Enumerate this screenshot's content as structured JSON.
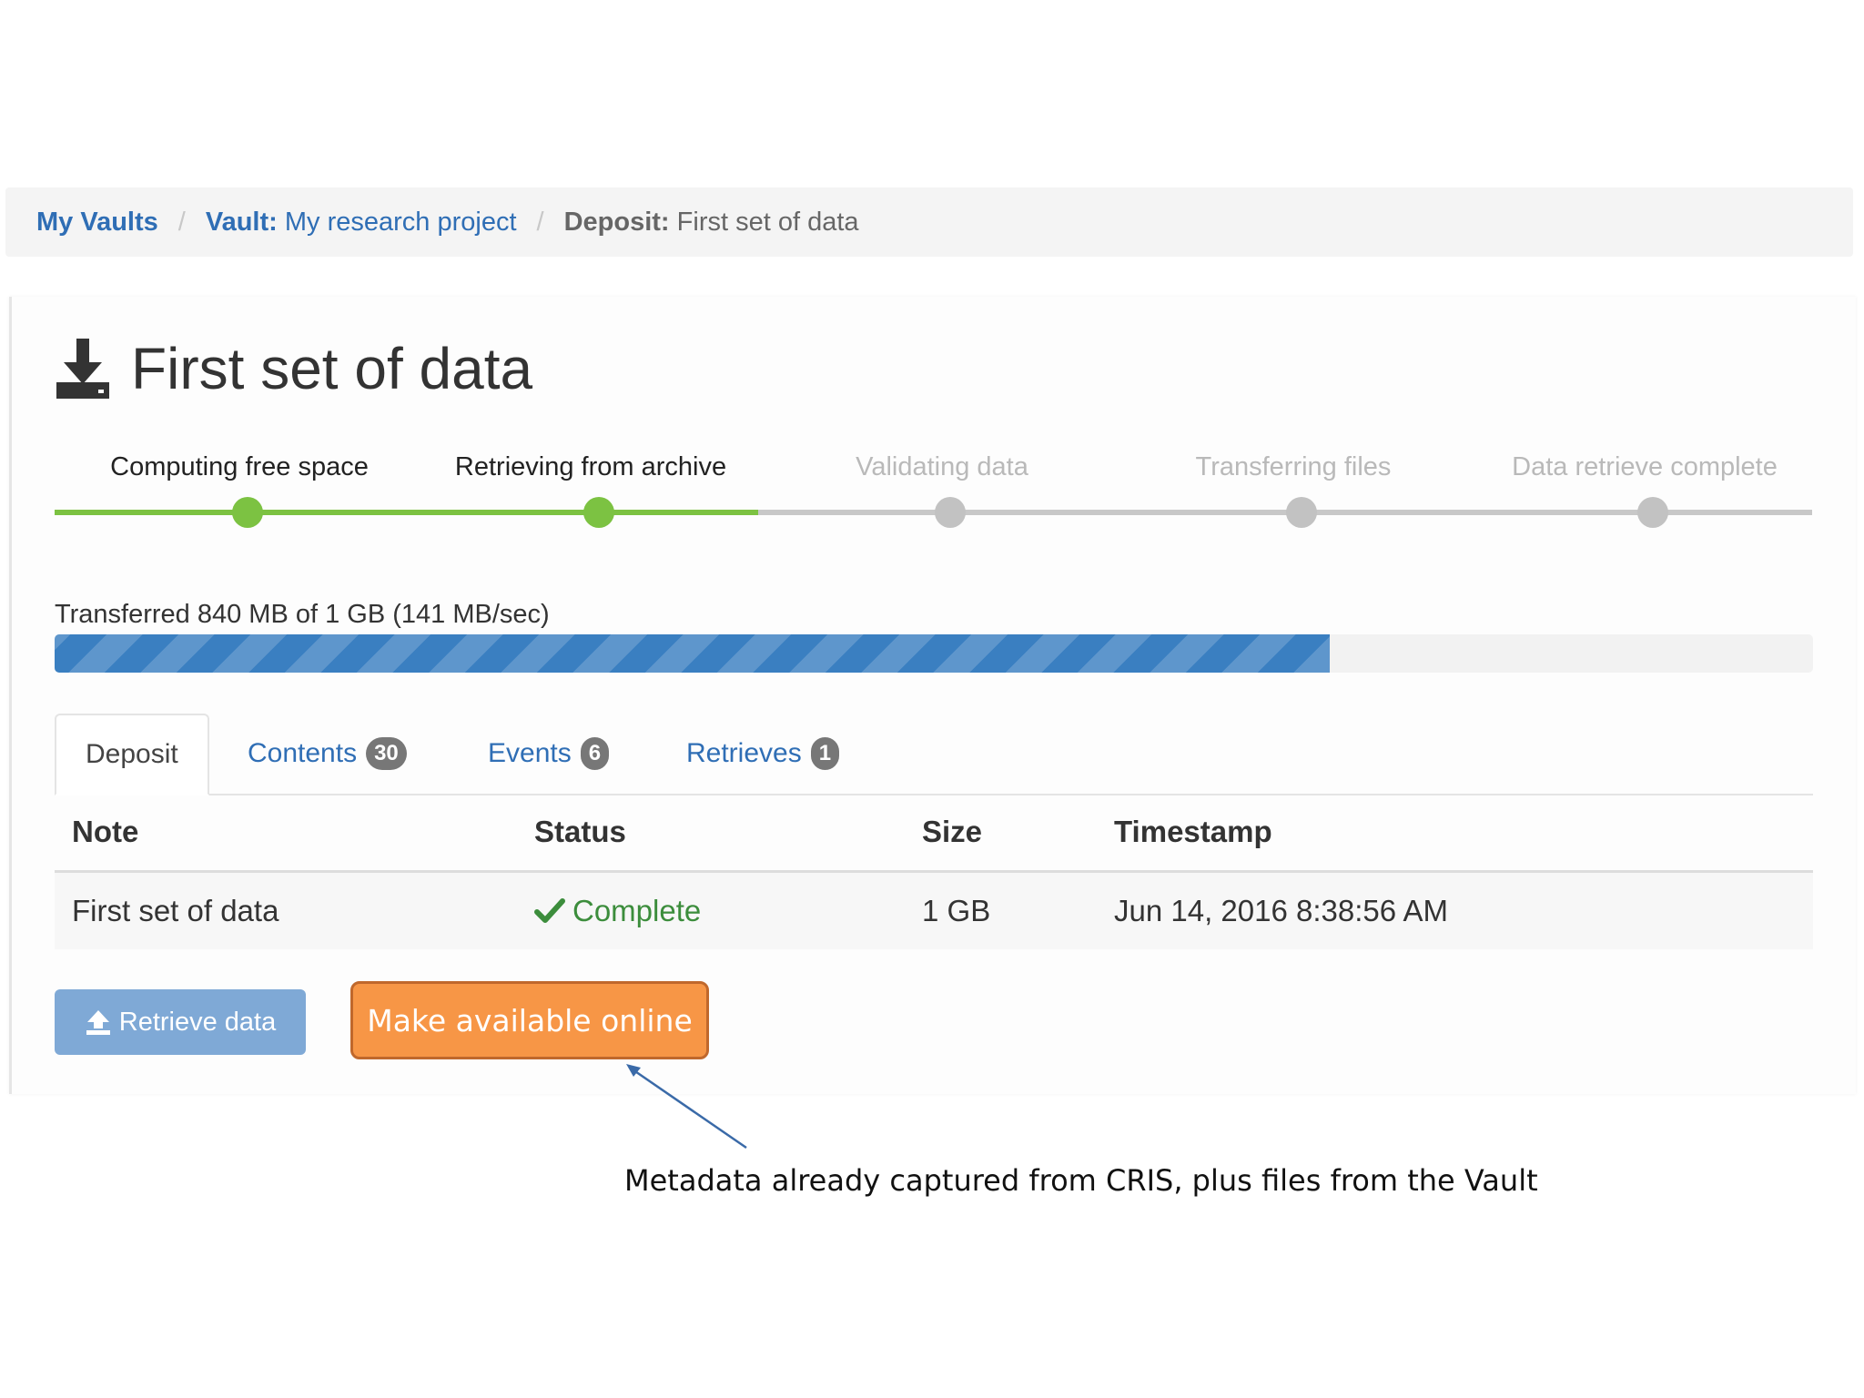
{
  "breadcrumb": {
    "items": [
      {
        "label": "My Vaults"
      },
      {
        "prefix": "Vault:",
        "label": "My research project"
      }
    ],
    "current": {
      "prefix": "Deposit:",
      "label": "First set of data"
    },
    "separator": "/"
  },
  "page": {
    "title": "First set of data",
    "title_icon": "download-icon"
  },
  "steps": [
    {
      "label": "Computing free space",
      "state": "done"
    },
    {
      "label": "Retrieving from archive",
      "state": "done"
    },
    {
      "label": "Validating data",
      "state": "pending"
    },
    {
      "label": "Transferring files",
      "state": "pending"
    },
    {
      "label": "Data retrieve complete",
      "state": "pending"
    }
  ],
  "progress": {
    "label": "Transferred 840 MB of 1 GB (141 MB/sec)",
    "fraction": 0.725
  },
  "tabs": [
    {
      "label": "Deposit",
      "active": true
    },
    {
      "label": "Contents",
      "badge": "30"
    },
    {
      "label": "Events",
      "badge": "6"
    },
    {
      "label": "Retrieves",
      "badge": "1"
    }
  ],
  "table": {
    "headers": [
      "Note",
      "Status",
      "Size",
      "Timestamp"
    ],
    "rows": [
      {
        "note": "First set of data",
        "status": "Complete",
        "size": "1 GB",
        "timestamp": "Jun 14, 2016 8:38:56 AM"
      }
    ]
  },
  "actions": {
    "retrieve_label": "Retrieve data",
    "make_online_label": "Make available online"
  },
  "annotation": {
    "text": "Metadata already captured from CRIS, plus files from the Vault"
  },
  "colors": {
    "link": "#2f6eb5",
    "step_done": "#7cc242",
    "step_pending": "#c2c2c2",
    "progress": "#3a7fc1",
    "status_complete": "#3c8d3c",
    "highlight_button": "#f79646"
  }
}
